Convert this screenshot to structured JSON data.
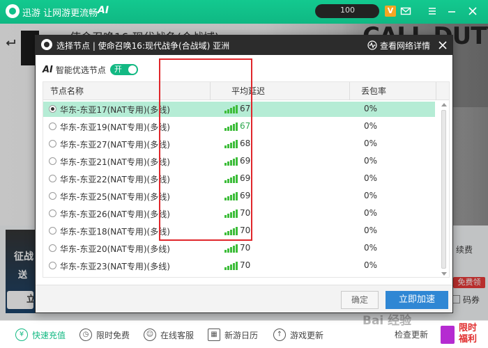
{
  "app": {
    "slogan": "迅游 让网游更流畅",
    "ai_badge": "AI",
    "search_text": "100",
    "vip": "V",
    "game_title": "使命召唤16:现代战争(合战域)",
    "cod_logo": "CALL DUTY"
  },
  "side": {
    "promo_title": "征战",
    "promo_send": "送",
    "promo_btn": "立",
    "renew": "续费",
    "free_get": "免费领",
    "coupon": "码券"
  },
  "bottom_bar": {
    "recharge": "快速充值",
    "free": "限时免费",
    "service": "在线客服",
    "calendar": "新游日历",
    "update": "游戏更新",
    "check_update": "检查更新",
    "limited_welfare": "限时福利"
  },
  "watermark": "Bai 经验",
  "dialog": {
    "title": "选择节点 | 使命召唤16:现代战争(合战域) 亚洲",
    "net_detail": "查看网络详情",
    "ai_logo": "AI",
    "ai_label": "智能优选节点",
    "ai_toggle": "开",
    "columns": {
      "name": "节点名称",
      "latency": "平均延迟",
      "loss": "丢包率"
    },
    "rows": [
      {
        "name": "华东-东亚17(NAT专用)(多线)",
        "latency": "67",
        "loss": "0%",
        "selected": true
      },
      {
        "name": "华东-东亚19(NAT专用)(多线)",
        "latency": "67",
        "loss": "0%",
        "latency_color": "#2fa84f"
      },
      {
        "name": "华东-东亚27(NAT专用)(多线)",
        "latency": "68",
        "loss": "0%"
      },
      {
        "name": "华东-东亚21(NAT专用)(多线)",
        "latency": "69",
        "loss": "0%"
      },
      {
        "name": "华东-东亚22(NAT专用)(多线)",
        "latency": "69",
        "loss": "0%"
      },
      {
        "name": "华东-东亚25(NAT专用)(多线)",
        "latency": "69",
        "loss": "0%"
      },
      {
        "name": "华东-东亚26(NAT专用)(多线)",
        "latency": "70",
        "loss": "0%"
      },
      {
        "name": "华东-东亚18(NAT专用)(多线)",
        "latency": "70",
        "loss": "0%"
      },
      {
        "name": "华东-东亚20(NAT专用)(多线)",
        "latency": "70",
        "loss": "0%"
      },
      {
        "name": "华东-东亚23(NAT专用)(多线)",
        "latency": "70",
        "loss": "0%"
      }
    ],
    "confirm": "确定",
    "speedup": "立即加速"
  },
  "colors": {
    "brand_green": "#13b983",
    "highlight_red": "#e0262b",
    "button_blue": "#2f87d4",
    "selected_row": "#b5ecd5"
  }
}
